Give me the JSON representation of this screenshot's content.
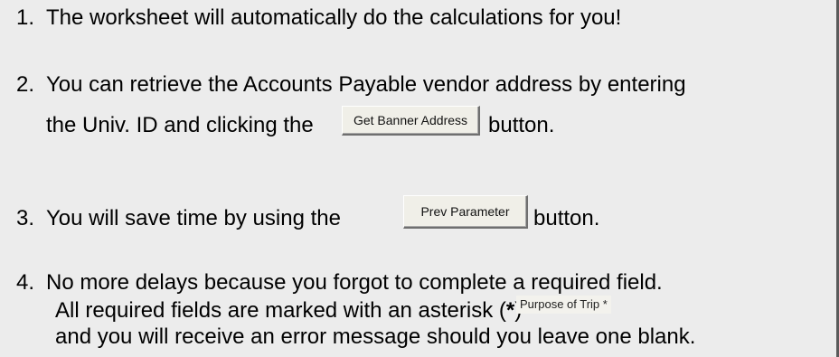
{
  "items": [
    {
      "number": "1.",
      "text": "The worksheet will automatically do the calculations for you!"
    },
    {
      "number": "2.",
      "line1": "You can retrieve the Accounts Payable vendor address by entering",
      "line2_before": "the Univ. ID and clicking the",
      "button_label": "Get Banner Address",
      "line2_after": "button."
    },
    {
      "number": "3.",
      "before": "You will save time by using the",
      "button_label": "Prev Parameter",
      "after": "button."
    },
    {
      "number": "4.",
      "line1": "No more delays because you forgot to complete a required field.",
      "line2_before": "All required fields are marked with an asterisk (",
      "asterisk": "*",
      "line2_mid": ")",
      "field_example": "Purpose of Trip *",
      "line3": "and you will receive an error message should you leave one blank."
    }
  ]
}
